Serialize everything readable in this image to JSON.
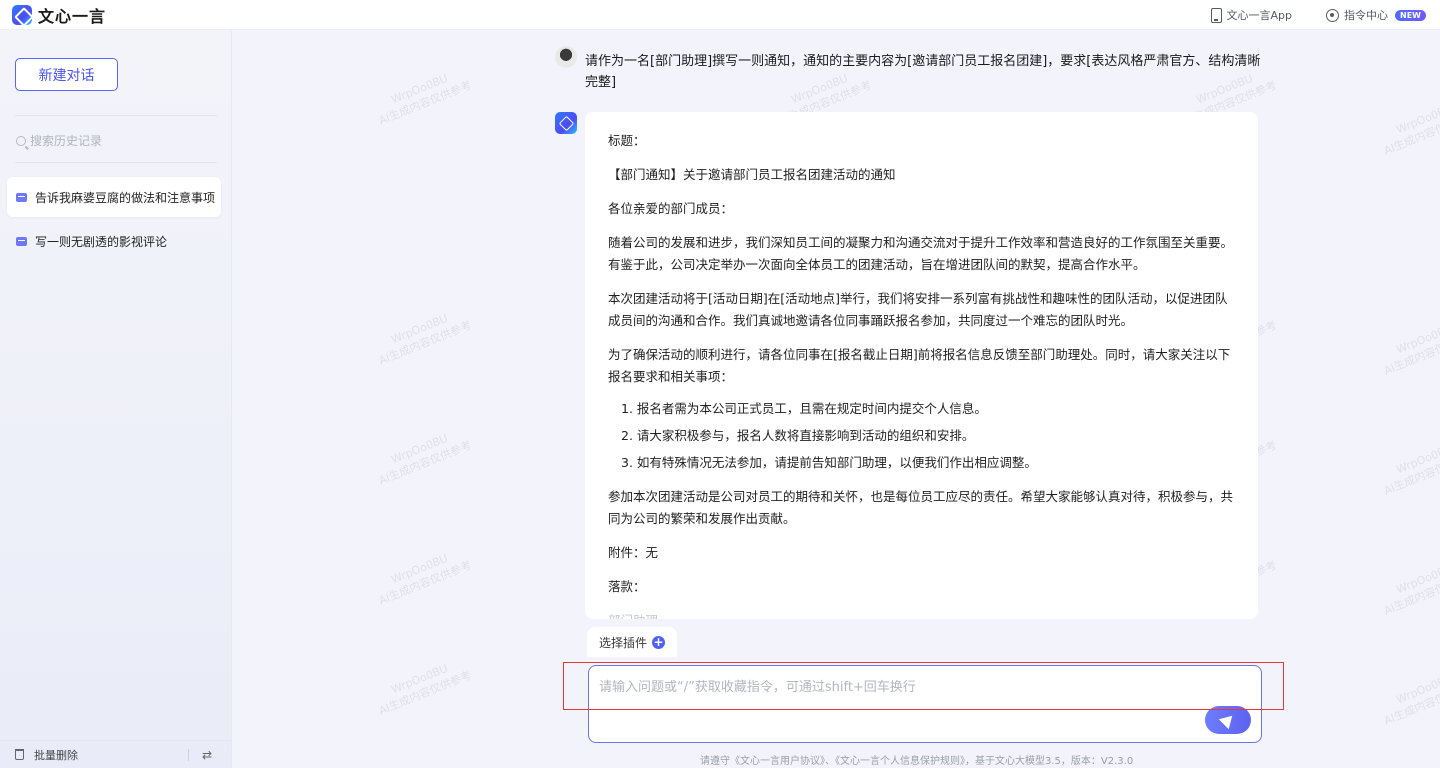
{
  "app": {
    "brand_name": "文心一言",
    "top_links": {
      "app_label": "文心一言App",
      "prompt_center_label": "指令中心",
      "new_badge": "NEW"
    }
  },
  "sidebar": {
    "new_chat_label": "新建对话",
    "search_placeholder": "搜索历史记录",
    "history": [
      {
        "title": "告诉我麻婆豆腐的做法和注意事项",
        "active": true
      },
      {
        "title": "写一则无剧透的影视评论",
        "active": false
      }
    ],
    "bulk_delete_label": "批量删除",
    "swap_symbol": "⇄"
  },
  "chat": {
    "user_question": "请作为一名[部门助理]撰写一则通知，通知的主要内容为[邀请部门员工报名团建]，要求[表达风格严肃官方、结构清晰完整]",
    "answer": {
      "p1": "标题：",
      "p2": "【部门通知】关于邀请部门员工报名团建活动的通知",
      "p3": "各位亲爱的部门成员：",
      "p4": "随着公司的发展和进步，我们深知员工间的凝聚力和沟通交流对于提升工作效率和营造良好的工作氛围至关重要。有鉴于此，公司决定举办一次面向全体员工的团建活动，旨在增进团队间的默契，提高合作水平。",
      "p5": "本次团建活动将于[活动日期]在[活动地点]举行，我们将安排一系列富有挑战性和趣味性的团队活动，以促进团队成员间的沟通和合作。我们真诚地邀请各位同事踊跃报名参加，共同度过一个难忘的团队时光。",
      "p6": "为了确保活动的顺利进行，请各位同事在[报名截止日期]前将报名信息反馈至部门助理处。同时，请大家关注以下报名要求和相关事项：",
      "list": [
        "1. 报名者需为本公司正式员工，且需在规定时间内提交个人信息。",
        "2. 请大家积极参与，报名人数将直接影响到活动的组织和安排。",
        "3. 如有特殊情况无法参加，请提前告知部门助理，以便我们作出相应调整。"
      ],
      "p7": "参加本次团建活动是公司对员工的期待和关怀，也是每位员工应尽的责任。希望大家能够认真对待，积极参与，共同为公司的繁荣和发展作出贡献。",
      "p8": "附件：无",
      "p9": "落款：",
      "p10": "部门助理"
    },
    "plugin_label": "选择插件",
    "input_placeholder": "请输入问题或“/”获取收藏指令，可通过shift+回车换行",
    "footer": "请遵守《文心一言用户协议》、《文心一言个人信息保护规则》，基于文心大模型3.5，版本：V2.3.0"
  },
  "watermark": {
    "line1": "WrpOo0BU",
    "line2": "AI生成内容仅供参考"
  }
}
